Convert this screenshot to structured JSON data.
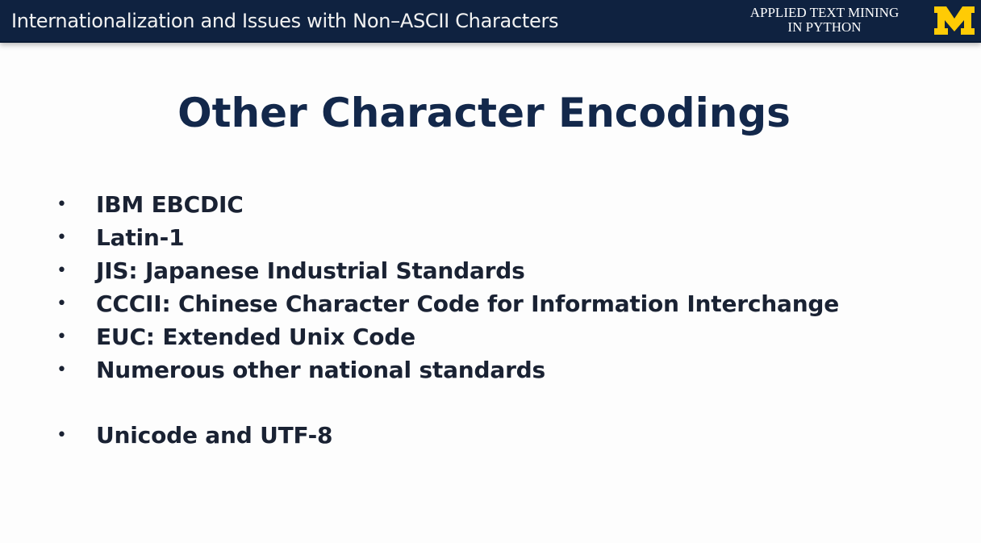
{
  "header": {
    "title": "Internationalization and Issues with Non–ASCII Characters",
    "course_line1": "APPLIED TEXT MINING",
    "course_line2": "IN PYTHON",
    "logo_letter": "M",
    "logo_color": "#ffcb05",
    "background": "#0f2240"
  },
  "slide": {
    "title": "Other Character Encodings",
    "bullets": [
      "IBM EBCDIC",
      "Latin-1",
      "JIS: Japanese Industrial Standards",
      "CCCII: Chinese Character Code for Information Interchange",
      "EUC: Extended Unix Code",
      "Numerous other national standards",
      "Unicode and UTF-8"
    ],
    "bullet_symbol": "•"
  }
}
